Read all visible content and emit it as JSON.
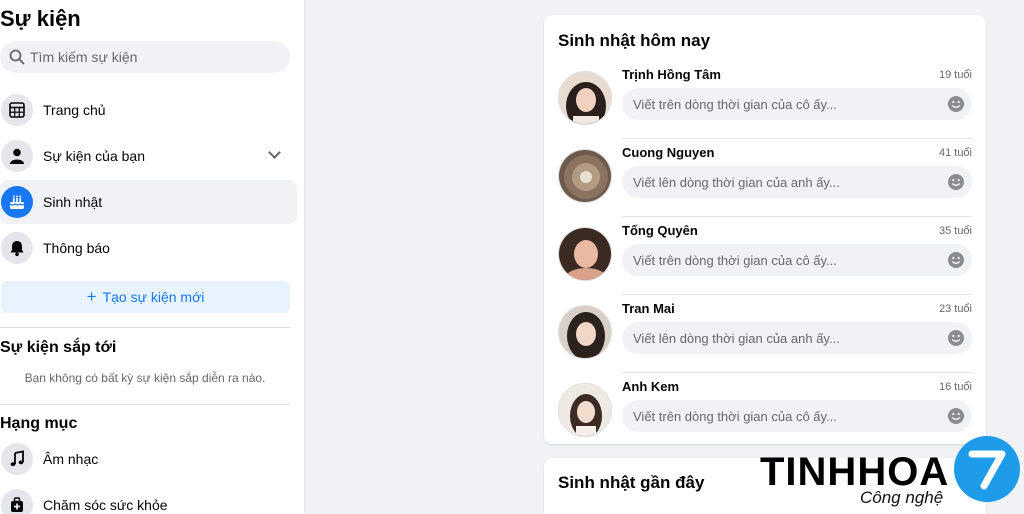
{
  "sidebar": {
    "title": "Sự kiện",
    "search_placeholder": "Tìm kiếm sự kiện",
    "nav": [
      {
        "label": "Trang chủ",
        "icon": "calendar-grid-icon"
      },
      {
        "label": "Sự kiện của bạn",
        "icon": "person-icon"
      },
      {
        "label": "Sinh nhật",
        "icon": "cake-icon"
      },
      {
        "label": "Thông báo",
        "icon": "bell-icon"
      }
    ],
    "create_label": "Tạo sự kiện mới",
    "upcoming_title": "Sự kiện sắp tới",
    "upcoming_empty": "Bạn không có bất kỳ sự kiện sắp diễn ra nào.",
    "categories_title": "Hạng mục",
    "categories": [
      {
        "label": "Âm nhạc",
        "icon": "music-note-icon"
      },
      {
        "label": "Chăm sóc sức khỏe",
        "icon": "health-icon"
      }
    ]
  },
  "today": {
    "title": "Sinh nhật hôm nay",
    "people": [
      {
        "name": "Trịnh Hồng Tâm",
        "age": "19 tuổi",
        "placeholder": "Viết trên dòng thời gian của cô ấy..."
      },
      {
        "name": "Cuong Nguyen",
        "age": "41 tuổi",
        "placeholder": "Viết lên dòng thời gian của anh ấy..."
      },
      {
        "name": "Tống Quyên",
        "age": "35 tuổi",
        "placeholder": "Viết trên dòng thời gian của cô ấy..."
      },
      {
        "name": "Tran Mai",
        "age": "23 tuổi",
        "placeholder": "Viết lên dòng thời gian của anh ấy..."
      },
      {
        "name": "Anh Kem",
        "age": "16 tuổi",
        "placeholder": "Viết trên dòng thời gian của cô ấy..."
      }
    ]
  },
  "recent": {
    "title": "Sinh nhật gần đây"
  },
  "watermark": {
    "brand": "TINHHOA",
    "subtitle": "Công nghệ"
  },
  "colors": {
    "accent": "#1877f2",
    "background": "#f0f2f5",
    "brand_logo": "#1e9be9"
  }
}
